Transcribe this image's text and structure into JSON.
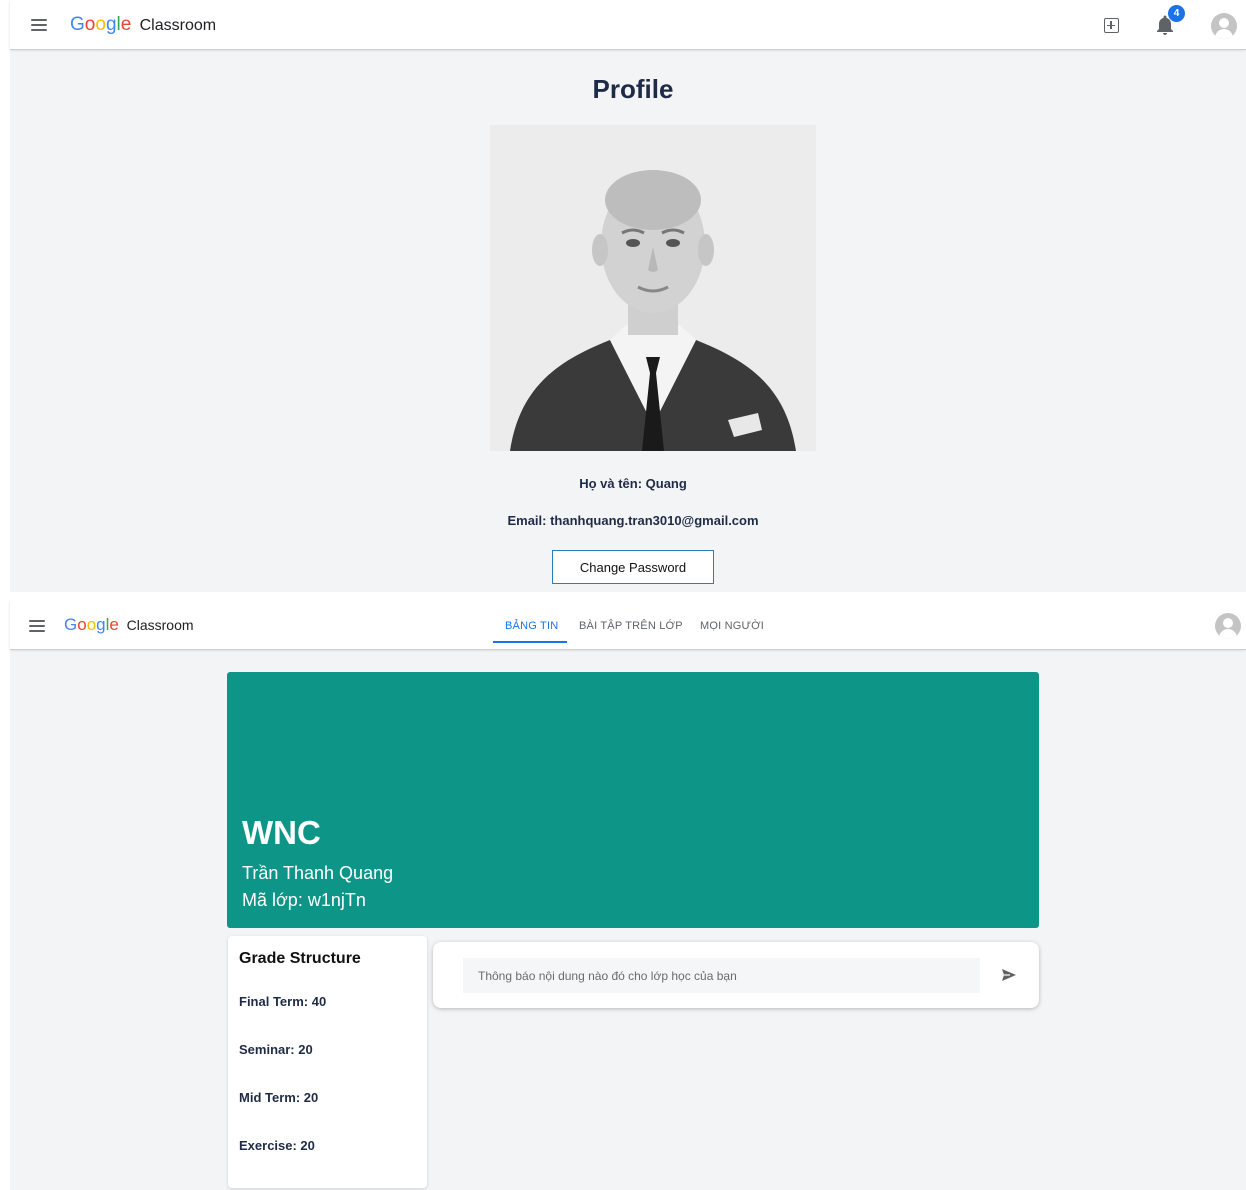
{
  "profile_screen": {
    "app_name": {
      "google": [
        "G",
        "o",
        "o",
        "g",
        "l",
        "e"
      ],
      "classroom": "Classroom"
    },
    "notification_count": "4",
    "title": "Profile",
    "full_name_line": "Họ và tên: Quang",
    "email_line": "Email: thanhquang.tran3010@gmail.com",
    "change_password_label": "Change Password"
  },
  "class_screen": {
    "app_name": {
      "google": [
        "G",
        "o",
        "o",
        "g",
        "l",
        "e"
      ],
      "classroom": "Classroom"
    },
    "tabs": [
      {
        "label": "BẢNG TIN",
        "active": true
      },
      {
        "label": "BÀI TẬP TRÊN LỚP",
        "active": false
      },
      {
        "label": "MỌI NGƯỜI",
        "active": false
      }
    ],
    "banner": {
      "color": "#0d9688",
      "class_name": "WNC",
      "teacher": "Trần Thanh Quang",
      "class_code": "Mã lớp: w1njTn"
    },
    "grade_structure": {
      "title": "Grade Structure",
      "items": [
        "Final Term: 40",
        "Seminar: 20",
        "Mid Term: 20",
        "Exercise: 20"
      ]
    },
    "post_placeholder": "Thông báo nội dung nào đó cho lớp học của bạn"
  },
  "colors": {
    "accent": "#1a73e8",
    "banner": "#0d9688",
    "button_border": "#2b7fb8"
  },
  "icons": [
    "menu-icon",
    "add-icon",
    "bell-icon",
    "account-icon",
    "send-icon"
  ]
}
